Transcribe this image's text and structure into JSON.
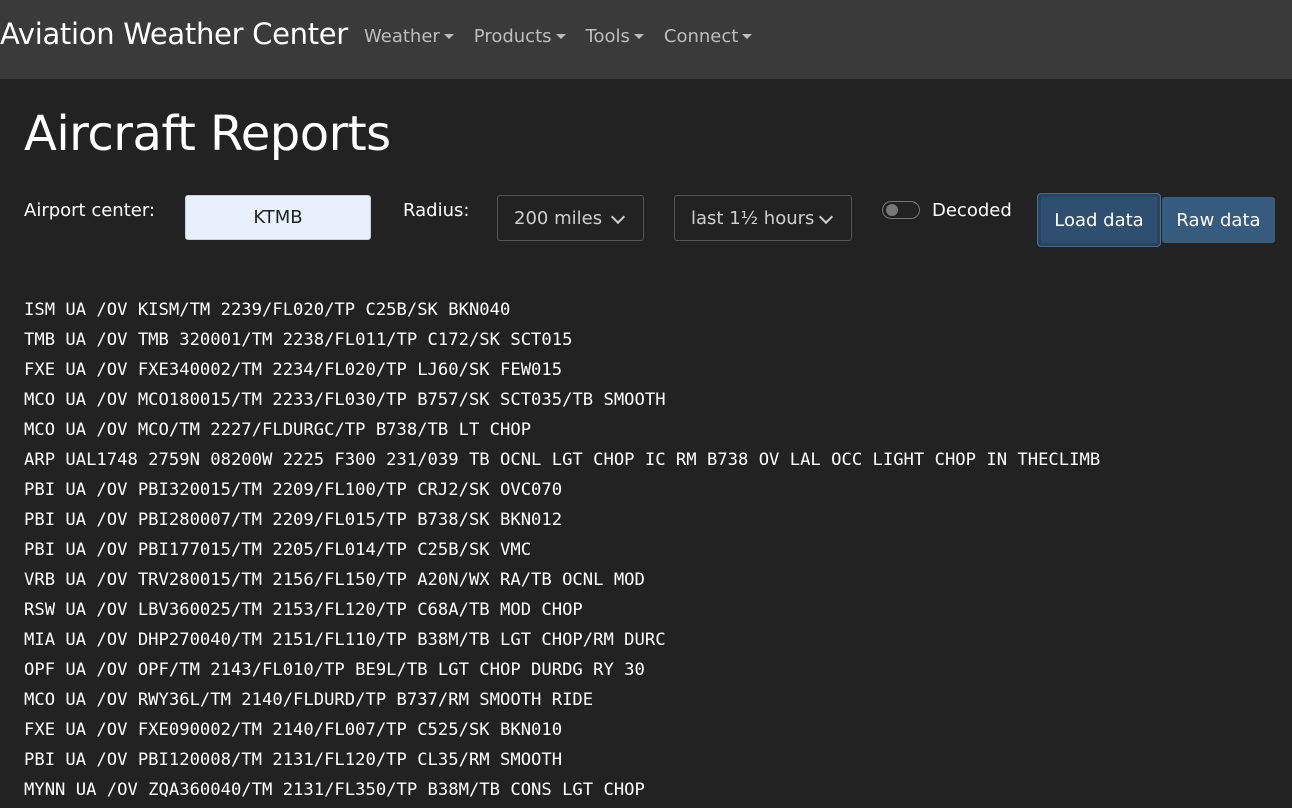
{
  "navbar": {
    "brand": "Aviation Weather Center",
    "items": [
      {
        "label": "Weather"
      },
      {
        "label": "Products"
      },
      {
        "label": "Tools"
      },
      {
        "label": "Connect"
      }
    ]
  },
  "page": {
    "title": "Aircraft Reports"
  },
  "form": {
    "airport_label": "Airport center:",
    "airport_value": "KTMB",
    "radius_label": "Radius:",
    "radius_value": "200 miles",
    "time_value": "last 1½ hours",
    "decoded_label": "Decoded",
    "decoded_on": false,
    "load_button": "Load data",
    "raw_button": "Raw data"
  },
  "reports": [
    "ISM UA /OV KISM/TM 2239/FL020/TP C25B/SK BKN040",
    "TMB UA /OV TMB 320001/TM 2238/FL011/TP C172/SK SCT015",
    "FXE UA /OV FXE340002/TM 2234/FL020/TP LJ60/SK FEW015",
    "MCO UA /OV MCO180015/TM 2233/FL030/TP B757/SK SCT035/TB SMOOTH",
    "MCO UA /OV MCO/TM 2227/FLDURGC/TP B738/TB LT CHOP",
    "ARP UAL1748 2759N 08200W 2225 F300 231/039 TB OCNL LGT CHOP IC RM B738 OV LAL OCC LIGHT CHOP IN THECLIMB",
    "PBI UA /OV PBI320015/TM 2209/FL100/TP CRJ2/SK OVC070",
    "PBI UA /OV PBI280007/TM 2209/FL015/TP B738/SK BKN012",
    "PBI UA /OV PBI177015/TM 2205/FL014/TP C25B/SK VMC",
    "VRB UA /OV TRV280015/TM 2156/FL150/TP A20N/WX RA/TB OCNL MOD",
    "RSW UA /OV LBV360025/TM 2153/FL120/TP C68A/TB MOD CHOP",
    "MIA UA /OV DHP270040/TM 2151/FL110/TP B38M/TB LGT CHOP/RM DURC",
    "OPF UA /OV OPF/TM 2143/FL010/TP BE9L/TB LGT CHOP DURDG RY 30",
    "MCO UA /OV RWY36L/TM 2140/FLDURD/TP B737/RM SMOOTH RIDE",
    "FXE UA /OV FXE090002/TM 2140/FL007/TP C525/SK BKN010",
    "PBI UA /OV PBI120008/TM 2131/FL120/TP CL35/RM SMOOTH",
    "MYNN UA /OV ZQA360040/TM 2131/FL350/TP B38M/TB CONS LGT CHOP"
  ]
}
